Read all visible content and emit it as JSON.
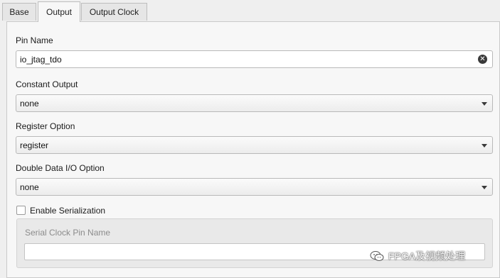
{
  "tabs": [
    {
      "label": "Base",
      "active": false
    },
    {
      "label": "Output",
      "active": true
    },
    {
      "label": "Output Clock",
      "active": false
    }
  ],
  "form": {
    "pin_name": {
      "label": "Pin Name",
      "value": "io_jtag_tdo"
    },
    "constant_output": {
      "label": "Constant Output",
      "value": "none"
    },
    "register_option": {
      "label": "Register Option",
      "value": "register"
    },
    "double_data": {
      "label": "Double Data I/O Option",
      "value": "none"
    },
    "serialization": {
      "label": "Enable Serialization",
      "checked": false
    },
    "serial_clock_pin": {
      "label": "Serial Clock Pin Name",
      "value": "",
      "disabled": true
    }
  },
  "watermark": {
    "text": "FPGA及视频处理",
    "icon": "wechat-icon"
  },
  "colors": {
    "panel_bg": "#f7f7f7",
    "window_bg": "#efefef",
    "disabled_text": "#8c8c8c"
  }
}
